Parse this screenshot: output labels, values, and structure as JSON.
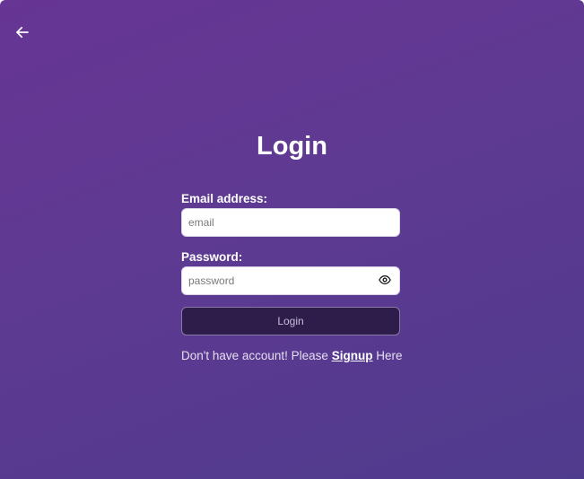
{
  "header": {
    "back_icon": "arrow-left-icon"
  },
  "page": {
    "title": "Login"
  },
  "form": {
    "email_label": "Email address:",
    "email_placeholder": "email",
    "email_value": "",
    "password_label": "Password:",
    "password_placeholder": "password",
    "password_value": "",
    "visibility_icon": "eye-icon",
    "submit_label": "Login"
  },
  "footer": {
    "prefix_text": "Don't have account! Please",
    "link_text": "Signup",
    "suffix_text": "Here"
  },
  "colors": {
    "background_start": "#673594",
    "background_end": "#4f3b8d",
    "button_bg": "#2e1d4b",
    "text_white": "#ffffff"
  }
}
